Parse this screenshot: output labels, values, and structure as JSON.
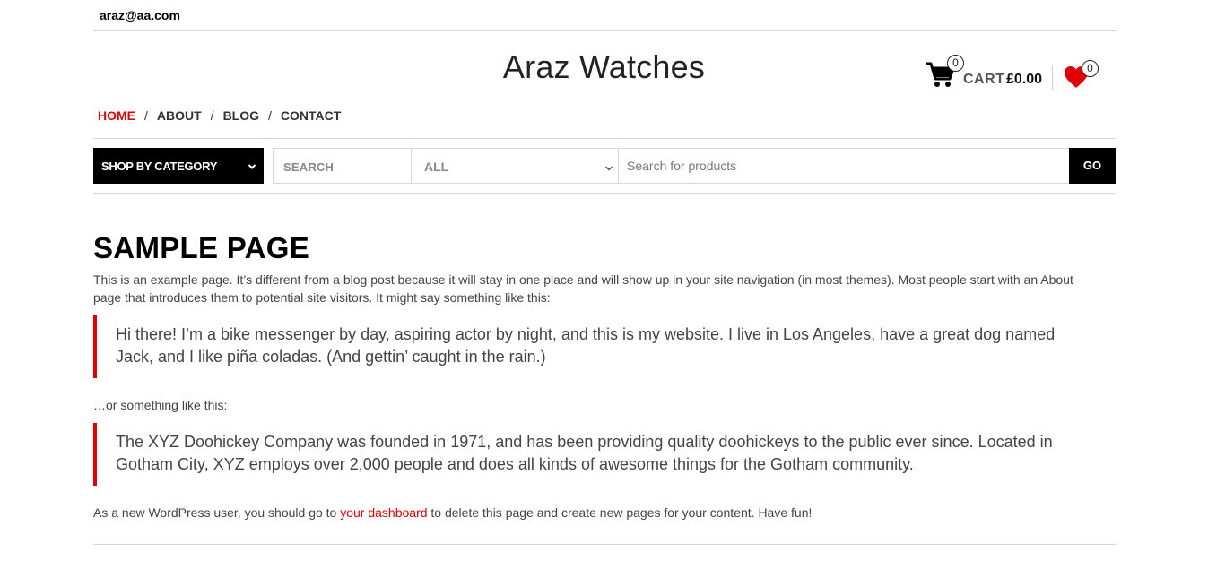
{
  "topbar": {
    "email": "araz@aa.com"
  },
  "header": {
    "site_title": "Araz Watches",
    "cart": {
      "count": "0",
      "label": "CART",
      "amount": "£0.00"
    },
    "wishlist": {
      "count": "0"
    }
  },
  "nav": {
    "items": [
      {
        "label": "HOME",
        "active": true
      },
      {
        "label": "ABOUT"
      },
      {
        "label": "BLOG"
      },
      {
        "label": "CONTACT"
      }
    ],
    "separator": "/"
  },
  "search": {
    "category_button": "SHOP BY CATEGORY",
    "label": "SEARCH",
    "category_select": "ALL",
    "placeholder": "Search for products",
    "go_label": "GO"
  },
  "content": {
    "title": "SAMPLE PAGE",
    "intro": "This is an example page. It’s different from a blog post because it will stay in one place and will show up in your site navigation (in most themes). Most people start with an About page that introduces them to potential site visitors. It might say something like this:",
    "quote1": "Hi there! I’m a bike messenger by day, aspiring actor by night, and this is my website. I live in Los Angeles, have a great dog named Jack, and I like piña coladas. (And gettin’ caught in the rain.)",
    "between": "…or something like this:",
    "quote2": "The XYZ Doohickey Company was founded in 1971, and has been providing quality doohickeys to the public ever since. Located in Gotham City, XYZ employs over 2,000 people and does all kinds of awesome things for the Gotham community.",
    "outro_before": "As a new WordPress user, you should go to ",
    "outro_link": "your dashboard",
    "outro_after": " to delete this page and create new pages for your content. Have fun!"
  },
  "colors": {
    "accent": "#e00000",
    "dark": "#000000",
    "border": "#d6d6d6"
  },
  "icons": [
    "cart-icon",
    "heart-icon",
    "chevron-down-icon"
  ]
}
